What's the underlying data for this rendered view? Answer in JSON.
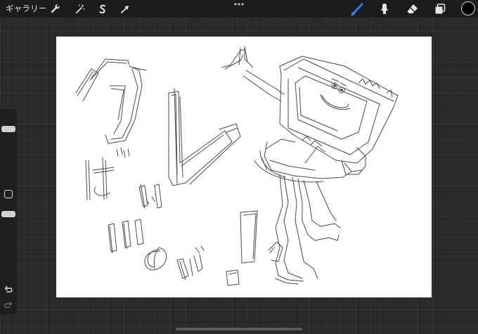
{
  "toolbar": {
    "gallery_label": "ギャラリー",
    "actions_icon": "wrench-icon",
    "adjustments_icon": "magic-wand-icon",
    "selection_icon": "selection-s-icon",
    "transform_icon": "arrow-cursor-icon",
    "more_icon": "ellipsis-icon",
    "brush_icon": "brush-icon",
    "smudge_icon": "smudge-icon",
    "eraser_icon": "eraser-icon",
    "layers_icon": "layers-icon",
    "active_color": "#000000",
    "active_tool_color": "#2f7cf6"
  },
  "sidebar": {
    "brush_size_level": 0.15,
    "opacity_level": 0.2,
    "modify_icon": "square-icon",
    "undo_icon": "undo-arrow-icon",
    "redo_icon": "redo-arrow-icon"
  }
}
